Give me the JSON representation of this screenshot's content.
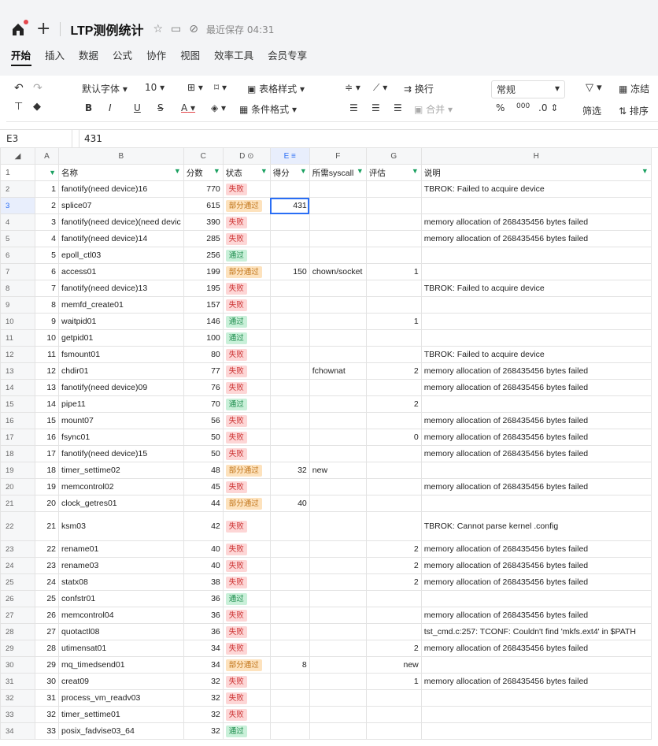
{
  "header": {
    "title": "LTP测例统计",
    "saved": "最近保存 04:31"
  },
  "menu": [
    "开始",
    "插入",
    "数据",
    "公式",
    "协作",
    "视图",
    "效率工具",
    "会员专享"
  ],
  "toolbar": {
    "font": "默认字体",
    "size": "10",
    "table_style": "表格样式",
    "wrap": "换行",
    "number_format": "常规",
    "freeze": "冻结",
    "cond_format": "条件格式",
    "merge": "合并",
    "percent": "%",
    "thousand": "000",
    "decimal": ".0",
    "filter": "筛选",
    "sort": "排序",
    "bold": "B",
    "italic": "I",
    "underline": "U",
    "strike": "S",
    "fontcolor": "A"
  },
  "formula": {
    "cell": "E3",
    "value": "431"
  },
  "columns": [
    "A",
    "B",
    "C",
    "D",
    "E",
    "F",
    "G",
    "H"
  ],
  "headers": {
    "a": "",
    "b": "名称",
    "c": "分数",
    "d": "状态",
    "e": "得分",
    "f": "所需syscall",
    "g": "评估",
    "h": "说明"
  },
  "rows": [
    {
      "r": "2",
      "a": "1",
      "b": "fanotify(need device)16",
      "c": "770",
      "d": "失败",
      "e": "",
      "f": "",
      "g": "",
      "h": "TBROK: Failed to acquire device"
    },
    {
      "r": "3",
      "a": "2",
      "b": "splice07",
      "c": "615",
      "d": "部分通过",
      "e": "431",
      "f": "",
      "g": "",
      "h": ""
    },
    {
      "r": "4",
      "a": "3",
      "b": "fanotify(need device)(need devic",
      "c": "390",
      "d": "失败",
      "e": "",
      "f": "",
      "g": "",
      "h": "memory allocation of 268435456 bytes failed"
    },
    {
      "r": "5",
      "a": "4",
      "b": "fanotify(need device)14",
      "c": "285",
      "d": "失败",
      "e": "",
      "f": "",
      "g": "",
      "h": "memory allocation of 268435456 bytes failed"
    },
    {
      "r": "6",
      "a": "5",
      "b": "epoll_ctl03",
      "c": "256",
      "d": "通过",
      "e": "",
      "f": "",
      "g": "",
      "h": ""
    },
    {
      "r": "7",
      "a": "6",
      "b": "access01",
      "c": "199",
      "d": "部分通过",
      "e": "150",
      "f": "chown/socket",
      "g": "1",
      "h": ""
    },
    {
      "r": "8",
      "a": "7",
      "b": "fanotify(need device)13",
      "c": "195",
      "d": "失败",
      "e": "",
      "f": "",
      "g": "",
      "h": "TBROK: Failed to acquire device"
    },
    {
      "r": "9",
      "a": "8",
      "b": "memfd_create01",
      "c": "157",
      "d": "失败",
      "e": "",
      "f": "",
      "g": "",
      "h": ""
    },
    {
      "r": "10",
      "a": "9",
      "b": "waitpid01",
      "c": "146",
      "d": "通过",
      "e": "",
      "f": "",
      "g": "1",
      "h": ""
    },
    {
      "r": "11",
      "a": "10",
      "b": "getpid01",
      "c": "100",
      "d": "通过",
      "e": "",
      "f": "",
      "g": "",
      "h": ""
    },
    {
      "r": "12",
      "a": "11",
      "b": "fsmount01",
      "c": "80",
      "d": "失败",
      "e": "",
      "f": "",
      "g": "",
      "h": "TBROK: Failed to acquire device"
    },
    {
      "r": "13",
      "a": "12",
      "b": "chdir01",
      "c": "77",
      "d": "失败",
      "e": "",
      "f": "fchownat",
      "g": "2",
      "h": "memory allocation of 268435456 bytes failed"
    },
    {
      "r": "14",
      "a": "13",
      "b": "fanotify(need device)09",
      "c": "76",
      "d": "失败",
      "e": "",
      "f": "",
      "g": "",
      "h": "memory allocation of 268435456 bytes failed"
    },
    {
      "r": "15",
      "a": "14",
      "b": "pipe11",
      "c": "70",
      "d": "通过",
      "e": "",
      "f": "",
      "g": "2",
      "h": ""
    },
    {
      "r": "16",
      "a": "15",
      "b": "mount07",
      "c": "56",
      "d": "失败",
      "e": "",
      "f": "",
      "g": "",
      "h": "memory allocation of 268435456 bytes failed"
    },
    {
      "r": "17",
      "a": "16",
      "b": "fsync01",
      "c": "50",
      "d": "失败",
      "e": "",
      "f": "",
      "g": "0",
      "h": "memory allocation of 268435456 bytes failed"
    },
    {
      "r": "18",
      "a": "17",
      "b": "fanotify(need device)15",
      "c": "50",
      "d": "失败",
      "e": "",
      "f": "",
      "g": "",
      "h": "memory allocation of 268435456 bytes failed"
    },
    {
      "r": "19",
      "a": "18",
      "b": "timer_settime02",
      "c": "48",
      "d": "部分通过",
      "e": "32",
      "f": "new",
      "g": "",
      "h": ""
    },
    {
      "r": "20",
      "a": "19",
      "b": "memcontrol02",
      "c": "45",
      "d": "失败",
      "e": "",
      "f": "",
      "g": "",
      "h": "memory allocation of 268435456 bytes failed"
    },
    {
      "r": "21",
      "a": "20",
      "b": "clock_getres01",
      "c": "44",
      "d": "部分通过",
      "e": "40",
      "f": "",
      "g": "",
      "h": ""
    },
    {
      "r": "22",
      "a": "21",
      "b": "ksm03",
      "c": "42",
      "d": "失败",
      "e": "",
      "f": "",
      "g": "",
      "h": "TBROK: Cannot parse kernel .config",
      "tall": true
    },
    {
      "r": "23",
      "a": "22",
      "b": "rename01",
      "c": "40",
      "d": "失败",
      "e": "",
      "f": "",
      "g": "2",
      "h": "memory allocation of 268435456 bytes failed"
    },
    {
      "r": "24",
      "a": "23",
      "b": "rename03",
      "c": "40",
      "d": "失败",
      "e": "",
      "f": "",
      "g": "2",
      "h": "memory allocation of 268435456 bytes failed"
    },
    {
      "r": "25",
      "a": "24",
      "b": "statx08",
      "c": "38",
      "d": "失败",
      "e": "",
      "f": "",
      "g": "2",
      "h": "memory allocation of 268435456 bytes failed"
    },
    {
      "r": "26",
      "a": "25",
      "b": "confstr01",
      "c": "36",
      "d": "通过",
      "e": "",
      "f": "",
      "g": "",
      "h": ""
    },
    {
      "r": "27",
      "a": "26",
      "b": "memcontrol04",
      "c": "36",
      "d": "失败",
      "e": "",
      "f": "",
      "g": "",
      "h": "memory allocation of 268435456 bytes failed"
    },
    {
      "r": "28",
      "a": "27",
      "b": "quotactl08",
      "c": "36",
      "d": "失败",
      "e": "",
      "f": "",
      "g": "",
      "h": "tst_cmd.c:257: TCONF: Couldn't find 'mkfs.ext4' in $PATH"
    },
    {
      "r": "29",
      "a": "28",
      "b": "utimensat01",
      "c": "34",
      "d": "失败",
      "e": "",
      "f": "",
      "g": "2",
      "h": "memory allocation of 268435456 bytes failed"
    },
    {
      "r": "30",
      "a": "29",
      "b": "mq_timedsend01",
      "c": "34",
      "d": "部分通过",
      "e": "8",
      "f": "",
      "g": "new",
      "h": ""
    },
    {
      "r": "31",
      "a": "30",
      "b": "creat09",
      "c": "32",
      "d": "失败",
      "e": "",
      "f": "",
      "g": "1",
      "h": "memory allocation of 268435456 bytes failed"
    },
    {
      "r": "32",
      "a": "31",
      "b": "process_vm_readv03",
      "c": "32",
      "d": "失败",
      "e": "",
      "f": "",
      "g": "",
      "h": ""
    },
    {
      "r": "33",
      "a": "32",
      "b": "timer_settime01",
      "c": "32",
      "d": "失败",
      "e": "",
      "f": "",
      "g": "",
      "h": ""
    },
    {
      "r": "34",
      "a": "33",
      "b": "posix_fadvise03_64",
      "c": "32",
      "d": "通过",
      "e": "",
      "f": "",
      "g": "",
      "h": ""
    }
  ],
  "status_colors": {
    "失败": "#fdd6d6",
    "通过": "#c9f0d9",
    "部分通过": "#fde2bd"
  }
}
